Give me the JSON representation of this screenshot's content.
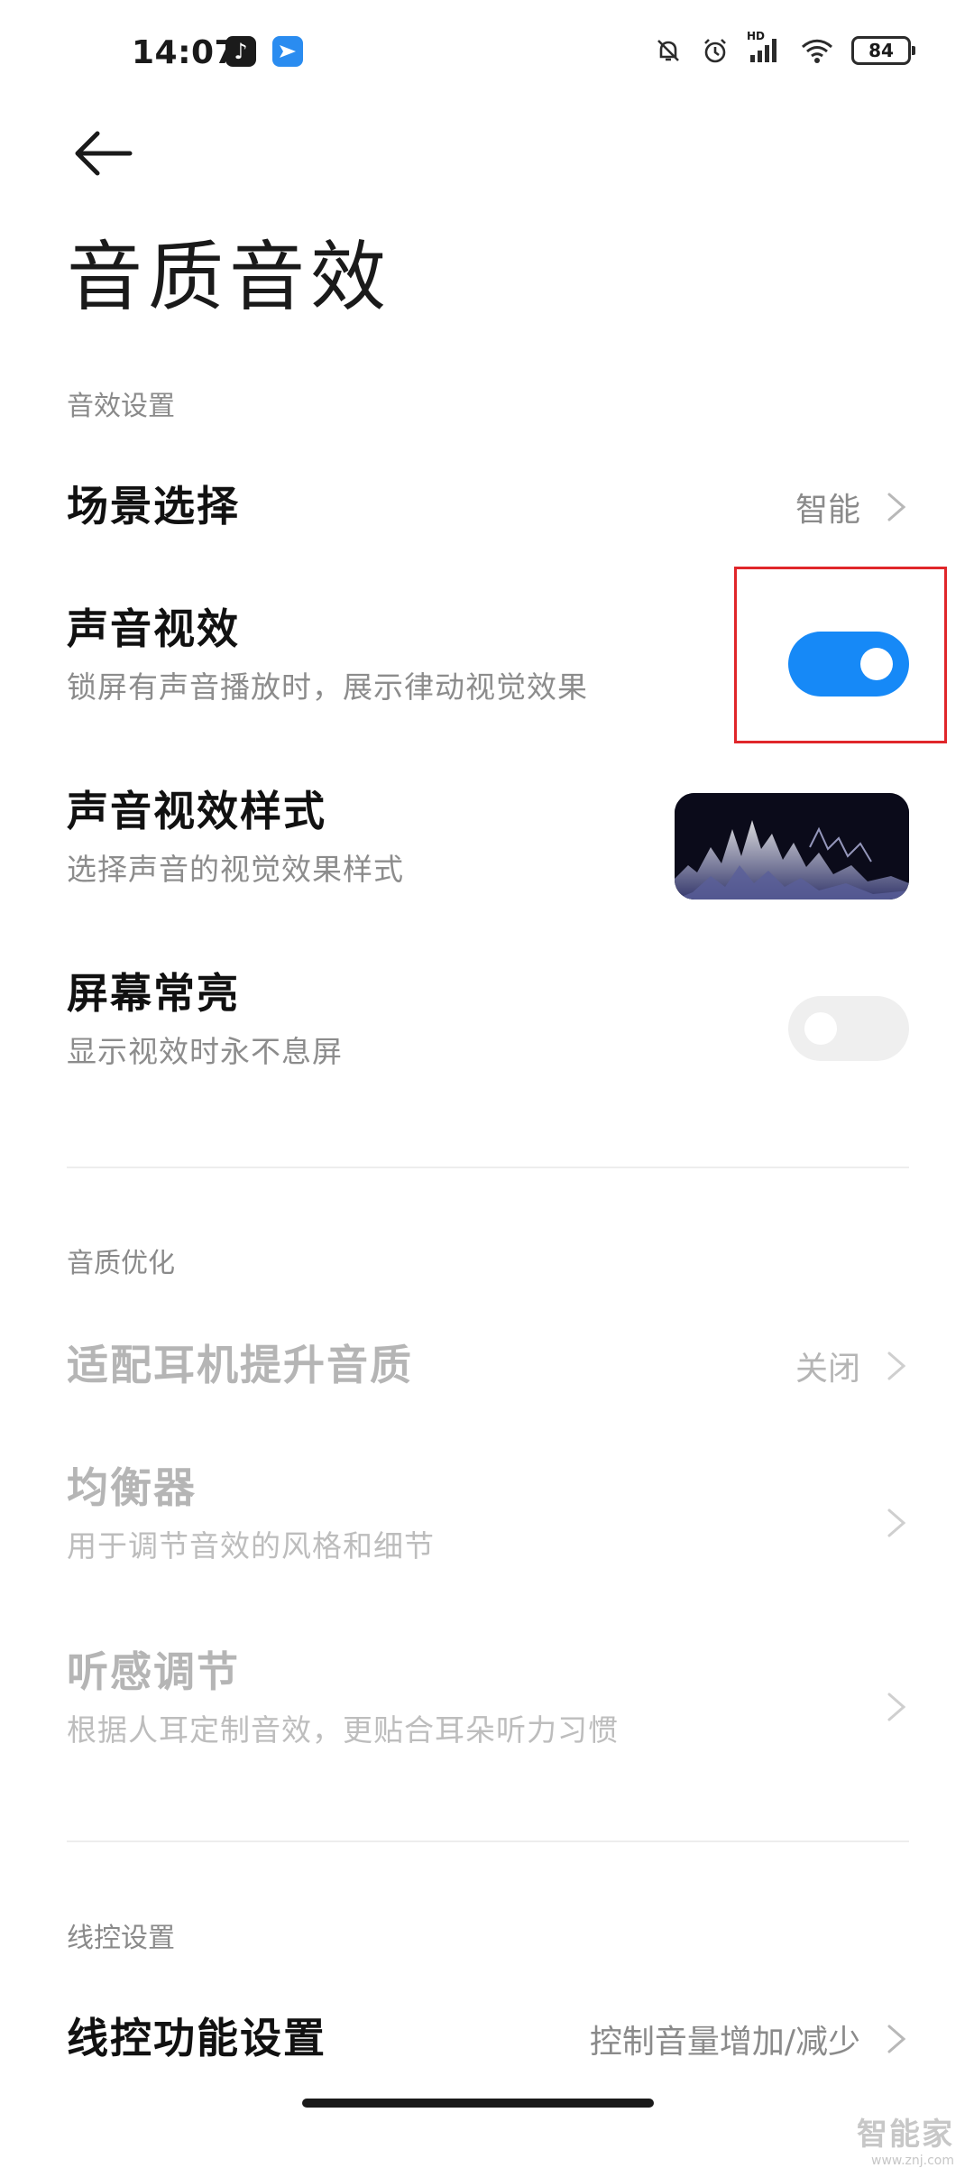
{
  "status_bar": {
    "time": "14:07",
    "battery": "84",
    "network_label": "HD",
    "icons": [
      "tiktok-icon",
      "feishu-icon",
      "bell-muted-icon",
      "alarm-icon",
      "signal-icon",
      "wifi-icon",
      "battery-icon"
    ]
  },
  "header": {
    "back_icon": "back-arrow-icon",
    "title": "音质音效"
  },
  "sections": {
    "effects": {
      "label": "音效设置"
    },
    "quality": {
      "label": "音质优化"
    },
    "wired": {
      "label": "线控设置"
    }
  },
  "rows": {
    "scene": {
      "title": "场景选择",
      "value": "智能"
    },
    "sound_visual": {
      "title": "声音视效",
      "subtitle": "锁屏有声音播放时，展示律动视觉效果",
      "toggle": "on"
    },
    "visual_style": {
      "title": "声音视效样式",
      "subtitle": "选择声音的视觉效果样式"
    },
    "screen_on": {
      "title": "屏幕常亮",
      "subtitle": "显示视效时永不息屏",
      "toggle": "off"
    },
    "earphone": {
      "title": "适配耳机提升音质",
      "value": "关闭"
    },
    "equalizer": {
      "title": "均衡器",
      "subtitle": "用于调节音效的风格和细节"
    },
    "hearing": {
      "title": "听感调节",
      "subtitle": "根据人耳定制音效，更贴合耳朵听力习惯"
    },
    "wired_control": {
      "title": "线控功能设置",
      "value": "控制音量增加/减少"
    }
  },
  "colors": {
    "accent": "#1689f7",
    "highlight": "#e0262a"
  },
  "watermark": {
    "main": "智能家",
    "sub": "www.znj.com"
  }
}
